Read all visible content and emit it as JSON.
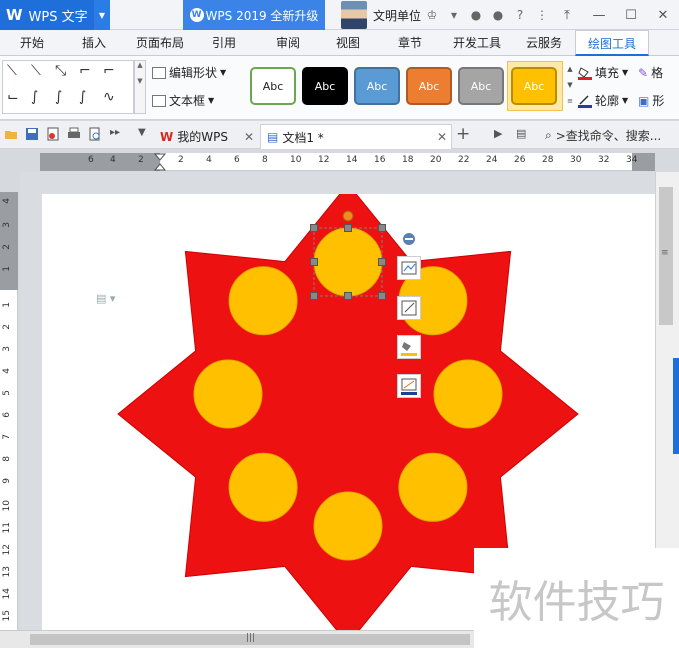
{
  "app": {
    "title": "WPS 文字",
    "logo_glyph": "W",
    "upgrade_label": "WPS 2019 全新升级",
    "user_name": "文明单位"
  },
  "title_icons": [
    "skin-icon",
    "cloud-icon",
    "share-icon",
    "help-icon",
    "settings-icon"
  ],
  "window_controls": [
    "minimize",
    "restore",
    "close"
  ],
  "ribbon_tabs": [
    "开始",
    "插入",
    "页面布局",
    "引用",
    "审阅",
    "视图",
    "章节",
    "开发工具",
    "云服务",
    "绘图工具"
  ],
  "active_tab": "绘图工具",
  "ribbon": {
    "edit_shape": "编辑形状",
    "text_box": "文本框",
    "fill": "填充",
    "outline": "轮廓",
    "format_brush": "格",
    "shape_effect": "形",
    "styles": [
      {
        "label": "Abc",
        "bg": "#ffffff",
        "border": "#6aa84f",
        "color": "#222222"
      },
      {
        "label": "Abc",
        "bg": "#000000",
        "border": "#000000",
        "color": "#ffffff"
      },
      {
        "label": "Abc",
        "bg": "#5b9bd5",
        "border": "#41719c",
        "color": "#ffffff"
      },
      {
        "label": "Abc",
        "bg": "#ed7d31",
        "border": "#ae5a21",
        "color": "#ffffff"
      },
      {
        "label": "Abc",
        "bg": "#a5a5a5",
        "border": "#787878",
        "color": "#ffffff"
      },
      {
        "label": "Abc",
        "bg": "#ffc000",
        "border": "#bc8c00",
        "color": "#ffffff"
      }
    ]
  },
  "doc_tabs": [
    {
      "label": "我的WPS",
      "icon": "wps-home-icon"
    },
    {
      "label": "文档1 *",
      "icon": "document-icon"
    }
  ],
  "search": {
    "placeholder": ">查找命令、搜索..."
  },
  "ruler": {
    "horizontal": [
      "6",
      "4",
      "2",
      "2",
      "4",
      "6",
      "8",
      "10",
      "12",
      "14",
      "16",
      "18",
      "20",
      "22",
      "24",
      "26",
      "28",
      "30",
      "32",
      "34"
    ],
    "vertical": [
      "4",
      "3",
      "2",
      "1",
      "1",
      "2",
      "3",
      "4",
      "5",
      "6",
      "7",
      "8",
      "9",
      "10",
      "11",
      "12",
      "13",
      "14",
      "15",
      "16"
    ]
  },
  "drawing": {
    "star_color": "#ee1111",
    "circle_color": "#ffc000",
    "circle_border": "#e0a800",
    "selection_color": "#7f7f7f"
  },
  "float_toolbar": [
    "layout-options-icon",
    "shape-style-icon",
    "fill-icon",
    "outline-icon"
  ],
  "watermark": "软件技巧"
}
